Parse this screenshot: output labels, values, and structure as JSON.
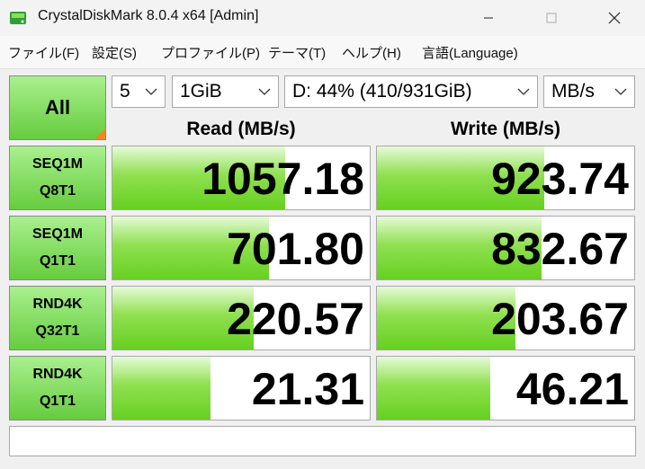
{
  "window": {
    "title": "CrystalDiskMark 8.0.4 x64 [Admin]"
  },
  "menu": {
    "items": [
      "ファイル(F)",
      "設定(S)",
      "プロファイル(P)",
      "テーマ(T)",
      "ヘルプ(H)",
      "言語(Language)"
    ]
  },
  "controls": {
    "all_label": "All",
    "count": "5",
    "size": "1GiB",
    "drive": "D: 44% (410/931GiB)",
    "unit": "MB/s"
  },
  "headers": {
    "read": "Read (MB/s)",
    "write": "Write (MB/s)"
  },
  "tests": [
    {
      "line1": "SEQ1M",
      "line2": "Q8T1",
      "read": "1057.18",
      "write": "923.74",
      "read_fill": 0.67,
      "write_fill": 0.65
    },
    {
      "line1": "SEQ1M",
      "line2": "Q1T1",
      "read": "701.80",
      "write": "832.67",
      "read_fill": 0.61,
      "write_fill": 0.64
    },
    {
      "line1": "RND4K",
      "line2": "Q32T1",
      "read": "220.57",
      "write": "203.67",
      "read_fill": 0.55,
      "write_fill": 0.54
    },
    {
      "line1": "RND4K",
      "line2": "Q1T1",
      "read": "21.31",
      "write": "46.21",
      "read_fill": 0.38,
      "write_fill": 0.44
    }
  ],
  "colors": {
    "bar_green": "#66d020",
    "button_green": "#66cc3e",
    "corner_orange": "#ee8a1c"
  },
  "comment": ""
}
